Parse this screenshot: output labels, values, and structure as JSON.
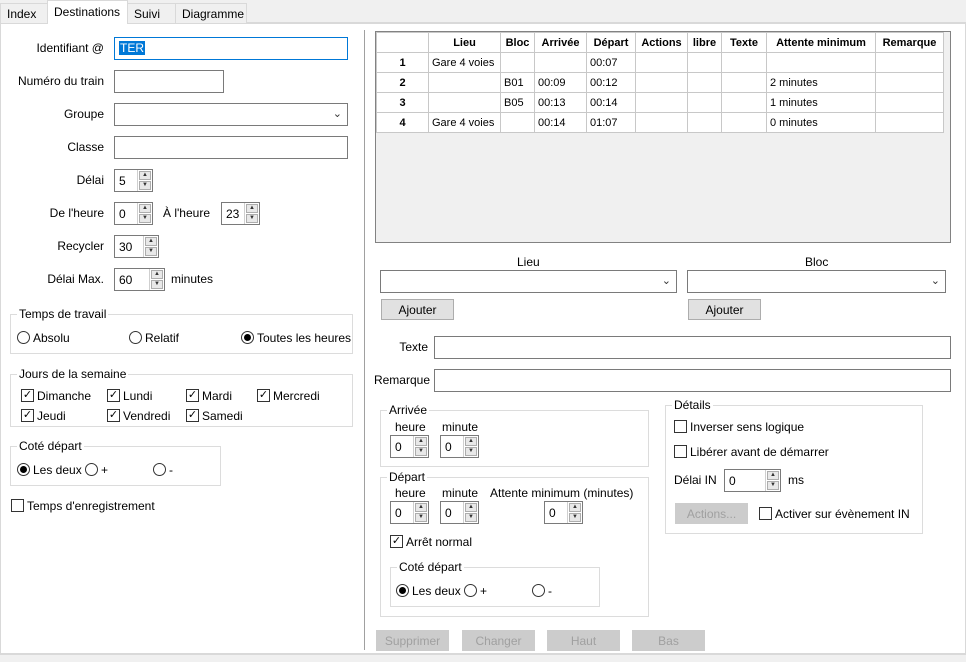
{
  "tabs": [
    "Index",
    "Destinations",
    "Suivi",
    "Diagramme"
  ],
  "left": {
    "identifiant_label": "Identifiant @",
    "identifiant_value": "TER",
    "numero_label": "Numéro du train",
    "numero_value": "",
    "groupe_label": "Groupe",
    "groupe_value": "",
    "classe_label": "Classe",
    "classe_value": "",
    "delai_label": "Délai",
    "delai_value": "5",
    "de_heure_label": "De l'heure",
    "de_heure_value": "0",
    "a_heure_label": "À l'heure",
    "a_heure_value": "23",
    "recycler_label": "Recycler",
    "recycler_value": "30",
    "delai_max_label": "Délai Max.",
    "delai_max_value": "60",
    "minutes_label": "minutes",
    "temps_title": "Temps de travail",
    "temps_options": [
      "Absolu",
      "Relatif",
      "Toutes les heures"
    ],
    "jours_title": "Jours de la semaine",
    "jours": [
      "Dimanche",
      "Lundi",
      "Mardi",
      "Mercredi",
      "Jeudi",
      "Vendredi",
      "Samedi"
    ],
    "cote_title": "Coté départ",
    "cote_options": [
      "Les deux",
      "+",
      "-"
    ],
    "enreg_label": "Temps d'enregistrement"
  },
  "table": {
    "headers": [
      "Lieu",
      "Bloc",
      "Arrivée",
      "Départ",
      "Actions",
      "libre",
      "Texte",
      "Attente minimum",
      "Remarque"
    ],
    "rows": [
      [
        "1",
        "Gare 4 voies",
        "",
        "",
        "00:07",
        "",
        "",
        "",
        "",
        ""
      ],
      [
        "2",
        "",
        "B01",
        "00:09",
        "00:12",
        "",
        "",
        "",
        "2 minutes",
        ""
      ],
      [
        "3",
        "",
        "B05",
        "00:13",
        "00:14",
        "",
        "",
        "",
        "1 minutes",
        ""
      ],
      [
        "4",
        "Gare 4 voies",
        "",
        "00:14",
        "01:07",
        "",
        "",
        "",
        "0 minutes",
        ""
      ]
    ]
  },
  "right": {
    "lieu_label": "Lieu",
    "bloc_label": "Bloc",
    "ajouter1": "Ajouter",
    "ajouter2": "Ajouter",
    "texte_label": "Texte",
    "remarque_label": "Remarque",
    "arrivee_title": "Arrivée",
    "heure": "heure",
    "minute": "minute",
    "arr_heure": "0",
    "arr_minute": "0",
    "depart_title": "Départ",
    "attente_label": "Attente minimum (minutes)",
    "dep_heure": "0",
    "dep_minute": "0",
    "dep_attente": "0",
    "arret_label": "Arrêt normal",
    "cote_title": "Coté départ",
    "cote_options": [
      "Les deux",
      "+",
      "-"
    ],
    "details_title": "Détails",
    "inverser_label": "Inverser sens logique",
    "liberer_label": "Libérer avant de démarrer",
    "delai_in_label": "Délai IN",
    "delai_in_value": "0",
    "ms_label": "ms",
    "actions_button": "Actions...",
    "activer_label": "Activer sur évènement IN"
  },
  "bottom_buttons": [
    "Supprimer",
    "Changer",
    "Haut",
    "Bas"
  ]
}
